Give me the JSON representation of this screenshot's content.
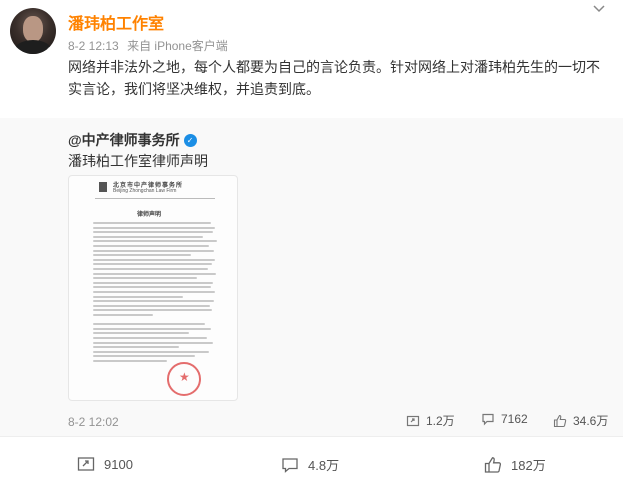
{
  "post": {
    "author": "潘玮柏工作室",
    "time": "8-2 12:13",
    "source": "来自 iPhone客户端",
    "text": "网络并非法外之地，每个人都要为自己的言论负责。针对网络上对潘玮柏先生的一切不实言论，我们将坚决维权，并追责到底。",
    "avatar_badge": "V"
  },
  "repost": {
    "author": "@中产律师事务所",
    "verify_icon": "blue-v-icon",
    "text": "潘玮柏工作室律师声明",
    "document": {
      "firm_cn": "北京市中产律师事务所",
      "firm_en": "Beijing Zhongchan Law Firm",
      "title": "律师声明"
    },
    "time": "8-2 12:02",
    "reposts": "1.2万",
    "comments": "7162",
    "likes": "34.6万"
  },
  "actions": {
    "reposts": "9100",
    "comments": "4.8万",
    "likes": "182万"
  },
  "colors": {
    "author_orange": "#ff8200",
    "verified_blue": "#1b8ee5",
    "meta_gray": "#939393",
    "repost_bg": "#f9f9f9"
  }
}
